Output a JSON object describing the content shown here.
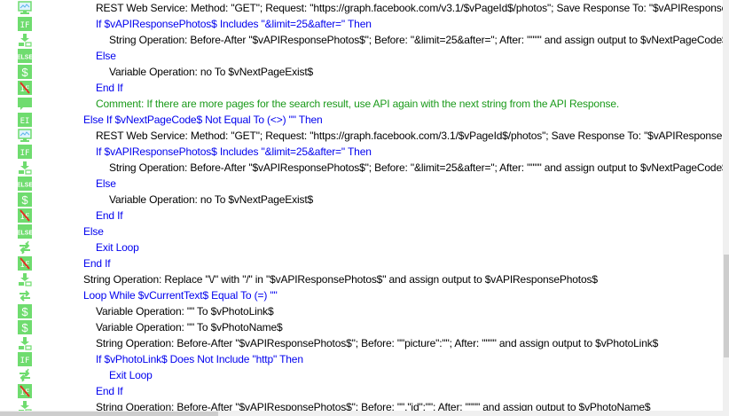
{
  "colors": {
    "keyword": "#0000ee",
    "command": "#000000",
    "comment": "#1a9a1a",
    "icon_green": "#6fdc6f"
  },
  "scrollbar": {
    "vertical_position_fraction": 0.62,
    "vertical_thumb_fraction": 0.25
  },
  "lines": [
    {
      "icon": "rest-web-service-icon",
      "indent": 2,
      "style": "black",
      "text": "REST Web Service: Method: \"GET\"; Request: \"https://graph.facebook.com/v3.1/$vPageId$/photos\"; Save Response To: \"$vAPIResponsePhotos$\""
    },
    {
      "icon": "if-icon",
      "indent": 2,
      "style": "blue",
      "text": "If $vAPIResponsePhotos$ Includes \"&limit=25&after=\" Then"
    },
    {
      "icon": "string-operation-icon",
      "indent": 3,
      "style": "black",
      "text": "String Operation: Before-After \"$vAPIResponsePhotos$\"; Before: \"&limit=25&after=\"; After: \"\"\"\" and assign output to $vNextPageCode$"
    },
    {
      "icon": "else-icon",
      "indent": 2,
      "style": "blue",
      "text": "Else"
    },
    {
      "icon": "variable-operation-icon",
      "indent": 3,
      "style": "black",
      "text": "Variable Operation: no To $vNextPageExist$"
    },
    {
      "icon": "end-if-icon",
      "indent": 2,
      "style": "blue",
      "text": "End If"
    },
    {
      "icon": "comment-icon",
      "indent": 2,
      "style": "green",
      "text": "Comment: If there are more pages for the search result, use API again with the next string from the API Response."
    },
    {
      "icon": "else-if-icon",
      "indent": 1,
      "style": "blue",
      "text": "Else If $vNextPageCode$ Not Equal To (<>) \"\" Then"
    },
    {
      "icon": "rest-web-service-icon",
      "indent": 2,
      "style": "black",
      "text": "REST Web Service: Method: \"GET\"; Request: \"https://graph.facebook.com/3.1/$vPageId$/photos\"; Save Response To: \"$vAPIResponsePhotos$\""
    },
    {
      "icon": "if-icon",
      "indent": 2,
      "style": "blue",
      "text": "If $vAPIResponsePhotos$ Includes \"&limit=25&after=\" Then"
    },
    {
      "icon": "string-operation-icon",
      "indent": 3,
      "style": "black",
      "text": "String Operation: Before-After \"$vAPIResponsePhotos$\"; Before: \"&limit=25&after=\"; After: \"\"\"\" and assign output to $vNextPageCode$"
    },
    {
      "icon": "else-icon",
      "indent": 2,
      "style": "blue",
      "text": "Else"
    },
    {
      "icon": "variable-operation-icon",
      "indent": 3,
      "style": "black",
      "text": "Variable Operation: no To $vNextPageExist$"
    },
    {
      "icon": "end-if-icon",
      "indent": 2,
      "style": "blue",
      "text": "End If"
    },
    {
      "icon": "else-icon",
      "indent": 1,
      "style": "blue",
      "text": "Else"
    },
    {
      "icon": "exit-loop-icon",
      "indent": 2,
      "style": "blue",
      "text": "Exit Loop"
    },
    {
      "icon": "end-if-icon",
      "indent": 1,
      "style": "blue",
      "text": "End If"
    },
    {
      "icon": "string-operation-icon",
      "indent": 1,
      "style": "black",
      "text": "String Operation: Replace \"\\/\" with \"/\" in \"$vAPIResponsePhotos$\" and assign output to $vAPIResponsePhotos$"
    },
    {
      "icon": "loop-icon",
      "indent": 1,
      "style": "blue",
      "text": "Loop While $vCurrentText$ Equal To (=) \"\""
    },
    {
      "icon": "variable-operation-icon",
      "indent": 2,
      "style": "black",
      "text": "Variable Operation: \"\" To $vPhotoLink$"
    },
    {
      "icon": "variable-operation-icon",
      "indent": 2,
      "style": "black",
      "text": "Variable Operation: \"\" To $vPhotoName$"
    },
    {
      "icon": "string-operation-icon",
      "indent": 2,
      "style": "black",
      "text": "String Operation: Before-After \"$vAPIResponsePhotos$\"; Before: \"\"picture\":\"\"; After: \"\"\"\" and assign output to $vPhotoLink$"
    },
    {
      "icon": "if-icon",
      "indent": 2,
      "style": "blue",
      "text": "If $vPhotoLink$ Does Not Include \"http\" Then"
    },
    {
      "icon": "exit-loop-icon",
      "indent": 3,
      "style": "blue",
      "text": "Exit Loop"
    },
    {
      "icon": "end-if-icon",
      "indent": 2,
      "style": "blue",
      "text": "End If"
    },
    {
      "icon": "string-operation-icon",
      "indent": 2,
      "style": "black",
      "text": "String Operation: Before-After \"$vAPIResponsePhotos$\"; Before: \"\",\"id\":\"\"; After: \"\"\"\" and assign output to $vPhotoName$"
    }
  ]
}
